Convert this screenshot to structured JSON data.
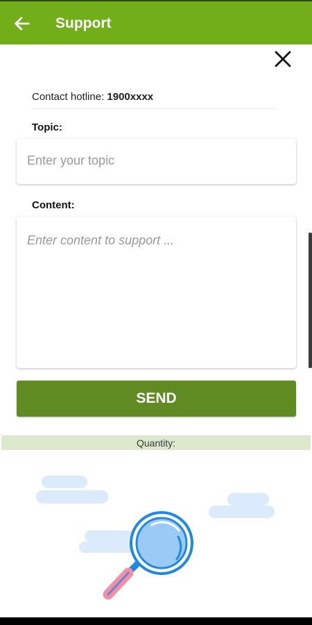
{
  "header": {
    "title": "Support",
    "back_icon": "arrow-left-icon",
    "bg_color": "#72ae1a"
  },
  "dialog": {
    "close_icon": "close-icon",
    "hotline_label": "Contact hotline:",
    "hotline_number": "1900xxxx",
    "topic_label": "Topic:",
    "topic_placeholder": "Enter your topic",
    "content_label": "Content:",
    "content_placeholder": "Enter content to support ...",
    "send_label": "SEND",
    "send_color": "#5f8b22"
  },
  "quantity_label": "Quantity:",
  "illustration": {
    "icon": "magnifier-icon",
    "decor": "cloud-icons"
  }
}
